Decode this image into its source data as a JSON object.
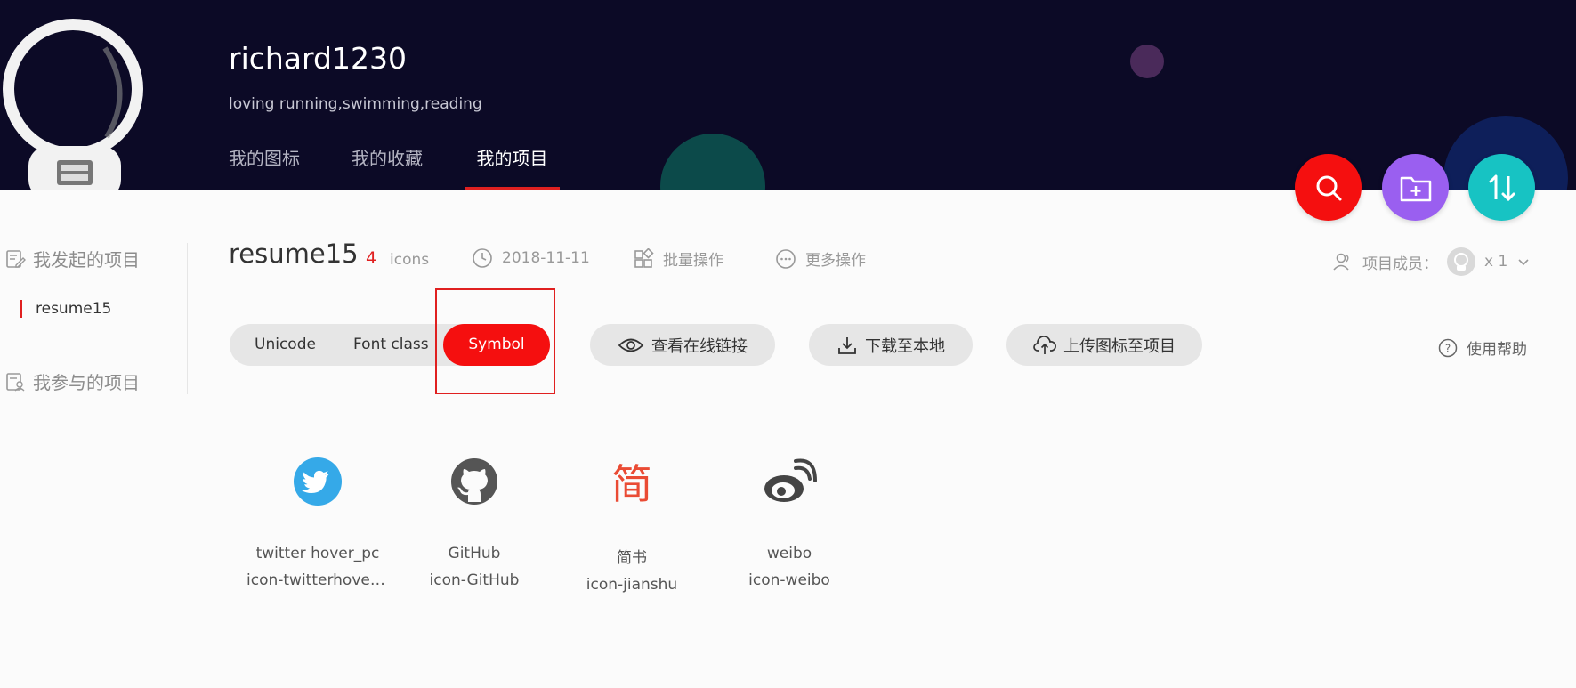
{
  "header": {
    "username": "richard1230",
    "tagline": "loving running,swimming,reading",
    "tabs": [
      {
        "label": "我的图标",
        "active": false
      },
      {
        "label": "我的收藏",
        "active": false
      },
      {
        "label": "我的项目",
        "active": true
      }
    ]
  },
  "fabs": [
    {
      "icon": "search-icon",
      "color": "#f50f0f"
    },
    {
      "icon": "add-folder-icon",
      "color": "#9a5ff0"
    },
    {
      "icon": "sort-icon",
      "color": "#17c3c3"
    }
  ],
  "sidebar": {
    "created_section": "我发起的项目",
    "created_items": [
      {
        "label": "resume15",
        "active": true
      }
    ],
    "joined_section": "我参与的项目"
  },
  "project": {
    "name": "resume15",
    "icon_count": "4",
    "icon_unit": "icons",
    "date": "2018-11-11",
    "batch_action": "批量操作",
    "more_action": "更多操作",
    "members_label": "项目成员：",
    "members_count": "x 1"
  },
  "modes": [
    {
      "label": "Unicode",
      "active": false
    },
    {
      "label": "Font class",
      "active": false
    },
    {
      "label": "Symbol",
      "active": true
    }
  ],
  "buttons": {
    "view_link": "查看在线链接",
    "download": "下载至本地",
    "upload": "上传图标至项目",
    "help": "使用帮助"
  },
  "icons": [
    {
      "name": "twitter hover_pc",
      "code": "icon-twitterhover...",
      "color": "#35a9e8"
    },
    {
      "name": "GitHub",
      "code": "icon-GitHub",
      "color": "#555555"
    },
    {
      "name": "简书",
      "code": "icon-jianshu",
      "color": "#ea4b34",
      "glyph": "简"
    },
    {
      "name": "weibo",
      "code": "icon-weibo",
      "color": "#444444"
    }
  ]
}
